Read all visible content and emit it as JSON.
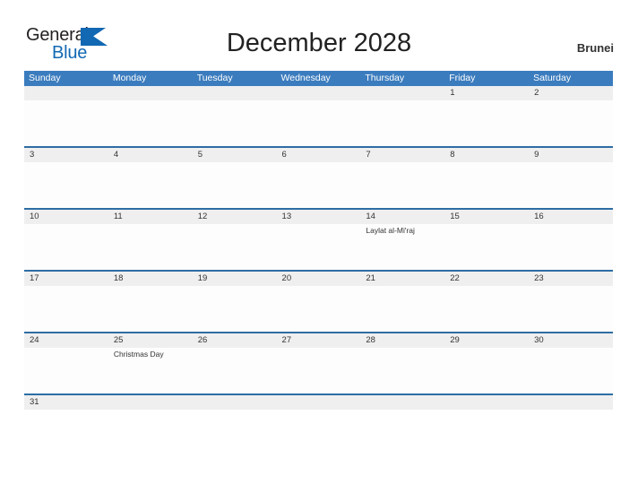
{
  "header": {
    "logo": {
      "text_primary": "General",
      "text_secondary": "Blue",
      "triangle_icon": "triangle-icon",
      "primary_color": "#231f20",
      "secondary_color": "#1268b3"
    },
    "title": "December 2028",
    "country": "Brunei"
  },
  "colors": {
    "header_blue": "#3b7cbe",
    "divider_blue": "#2e6da4",
    "daynum_strip_gray": "#efefef",
    "text_dark": "#333333"
  },
  "calendar": {
    "weekdays": [
      "Sunday",
      "Monday",
      "Tuesday",
      "Wednesday",
      "Thursday",
      "Friday",
      "Saturday"
    ],
    "weeks": [
      {
        "days": [
          {
            "num": "",
            "event": ""
          },
          {
            "num": "",
            "event": ""
          },
          {
            "num": "",
            "event": ""
          },
          {
            "num": "",
            "event": ""
          },
          {
            "num": "",
            "event": ""
          },
          {
            "num": "1",
            "event": ""
          },
          {
            "num": "2",
            "event": ""
          }
        ]
      },
      {
        "days": [
          {
            "num": "3",
            "event": ""
          },
          {
            "num": "4",
            "event": ""
          },
          {
            "num": "5",
            "event": ""
          },
          {
            "num": "6",
            "event": ""
          },
          {
            "num": "7",
            "event": ""
          },
          {
            "num": "8",
            "event": ""
          },
          {
            "num": "9",
            "event": ""
          }
        ]
      },
      {
        "days": [
          {
            "num": "10",
            "event": ""
          },
          {
            "num": "11",
            "event": ""
          },
          {
            "num": "12",
            "event": ""
          },
          {
            "num": "13",
            "event": ""
          },
          {
            "num": "14",
            "event": "Laylat al-Mi'raj"
          },
          {
            "num": "15",
            "event": ""
          },
          {
            "num": "16",
            "event": ""
          }
        ]
      },
      {
        "days": [
          {
            "num": "17",
            "event": ""
          },
          {
            "num": "18",
            "event": ""
          },
          {
            "num": "19",
            "event": ""
          },
          {
            "num": "20",
            "event": ""
          },
          {
            "num": "21",
            "event": ""
          },
          {
            "num": "22",
            "event": ""
          },
          {
            "num": "23",
            "event": ""
          }
        ]
      },
      {
        "days": [
          {
            "num": "24",
            "event": ""
          },
          {
            "num": "25",
            "event": "Christmas Day"
          },
          {
            "num": "26",
            "event": ""
          },
          {
            "num": "27",
            "event": ""
          },
          {
            "num": "28",
            "event": ""
          },
          {
            "num": "29",
            "event": ""
          },
          {
            "num": "30",
            "event": ""
          }
        ]
      },
      {
        "days": [
          {
            "num": "31",
            "event": ""
          },
          {
            "num": "",
            "event": ""
          },
          {
            "num": "",
            "event": ""
          },
          {
            "num": "",
            "event": ""
          },
          {
            "num": "",
            "event": ""
          },
          {
            "num": "",
            "event": ""
          },
          {
            "num": "",
            "event": ""
          }
        ]
      }
    ]
  }
}
